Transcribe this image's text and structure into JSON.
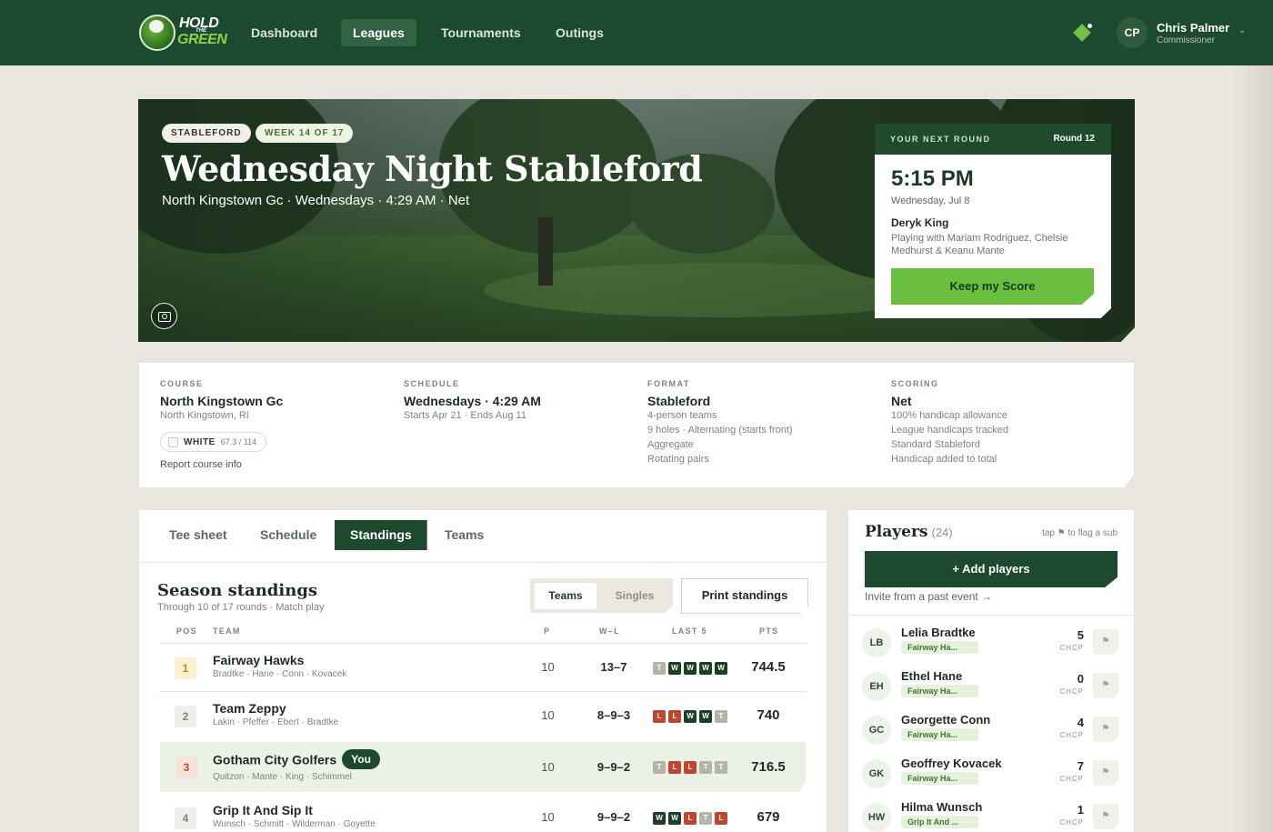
{
  "nav": {
    "logo": {
      "line1": "HOLD",
      "line2": "THE",
      "line3": "GREEN"
    },
    "links": [
      {
        "label": "Dashboard",
        "active": false
      },
      {
        "label": "Leagues",
        "active": true
      },
      {
        "label": "Tournaments",
        "active": false
      },
      {
        "label": "Outings",
        "active": false
      }
    ],
    "user": {
      "initials": "CP",
      "name": "Chris Palmer",
      "role": "Commissioner"
    }
  },
  "hero": {
    "badges": [
      "STABLEFORD",
      "WEEK 14 OF 17"
    ],
    "title": "Wednesday Night Stableford",
    "subtitle": "North Kingstown Gc · Wednesdays · 4:29 AM · Net"
  },
  "next_round": {
    "label": "YOUR NEXT ROUND",
    "round": "Round 12",
    "time": "5:15 PM",
    "date": "Wednesday, Jul 8",
    "player": "Deryk King",
    "playing_with": "Playing with Mariam Rodriguez, Chelsie Medhurst & Keanu Mante",
    "button": "Keep my Score"
  },
  "info": {
    "course": {
      "label": "COURSE",
      "value": "North Kingstown Gc",
      "location": "North Kingstown, RI",
      "tee_name": "WHITE",
      "tee_rating": "67.3 / 114",
      "report": "Report course info"
    },
    "schedule": {
      "label": "SCHEDULE",
      "value": "Wednesdays · 4:29 AM",
      "lines": [
        "Starts Apr 21 · Ends Aug 11"
      ]
    },
    "format": {
      "label": "FORMAT",
      "value": "Stableford",
      "lines": [
        "4-person teams",
        "9 holes · Alternating (starts front)",
        "Aggregate",
        "Rotating pairs"
      ]
    },
    "scoring": {
      "label": "SCORING",
      "value": "Net",
      "lines": [
        "100% handicap allowance",
        "League handicaps tracked",
        "Standard Stableford",
        "Handicap added to total"
      ]
    }
  },
  "tabs": [
    {
      "label": "Tee sheet",
      "active": false
    },
    {
      "label": "Schedule",
      "active": false
    },
    {
      "label": "Standings",
      "active": true
    },
    {
      "label": "Teams",
      "active": false
    }
  ],
  "standings": {
    "title": "Season standings",
    "subtitle": "Through 10 of 17 rounds · Match play",
    "toggle": [
      "Teams",
      "Singles"
    ],
    "print": "Print standings",
    "headers": {
      "pos": "POS",
      "team": "TEAM",
      "p": "P",
      "wl": "W–L",
      "last5": "LAST 5",
      "pts": "PTS"
    },
    "rows": [
      {
        "pos": "1",
        "team": "Fairway Hawks",
        "members": "Bradtke · Hane · Conn · Kovacek",
        "p": "10",
        "wl": "13–7",
        "last5": [
          "T",
          "W",
          "W",
          "W",
          "W"
        ],
        "pts": "744.5",
        "you": false
      },
      {
        "pos": "2",
        "team": "Team Zeppy",
        "members": "Lakin · Pfeffer · Ebert · Bradtke",
        "p": "10",
        "wl": "8–9–3",
        "last5": [
          "L",
          "L",
          "W",
          "W",
          "T"
        ],
        "pts": "740",
        "you": false
      },
      {
        "pos": "3",
        "team": "Gotham City Golfers",
        "members": "Quitzon · Mante · King · Schimmel",
        "p": "10",
        "wl": "9–9–2",
        "last5": [
          "T",
          "L",
          "L",
          "T",
          "T"
        ],
        "pts": "716.5",
        "you": true,
        "you_label": "You"
      },
      {
        "pos": "4",
        "team": "Grip It And Sip It",
        "members": "Wunsch · Schmitt · Wilderman · Goyette",
        "p": "10",
        "wl": "9–9–2",
        "last5": [
          "W",
          "W",
          "L",
          "T",
          "L"
        ],
        "pts": "679",
        "you": false
      }
    ]
  },
  "players": {
    "title": "Players",
    "count": "(24)",
    "tip": "tap ⚑ to flag a sub",
    "add": "+ Add players",
    "invite": "Invite from a past event →",
    "hcp_label": "CHCP",
    "list": [
      {
        "initials": "LB",
        "name": "Lelia Bradtke",
        "team": "Fairway Ha...",
        "hcp": "5"
      },
      {
        "initials": "EH",
        "name": "Ethel Hane",
        "team": "Fairway Ha...",
        "hcp": "0"
      },
      {
        "initials": "GC",
        "name": "Georgette Conn",
        "team": "Fairway Ha...",
        "hcp": "4"
      },
      {
        "initials": "GK",
        "name": "Geoffrey Kovacek",
        "team": "Fairway Ha...",
        "hcp": "7"
      },
      {
        "initials": "HW",
        "name": "Hilma Wunsch",
        "team": "Grip It And ...",
        "hcp": "1"
      }
    ]
  }
}
